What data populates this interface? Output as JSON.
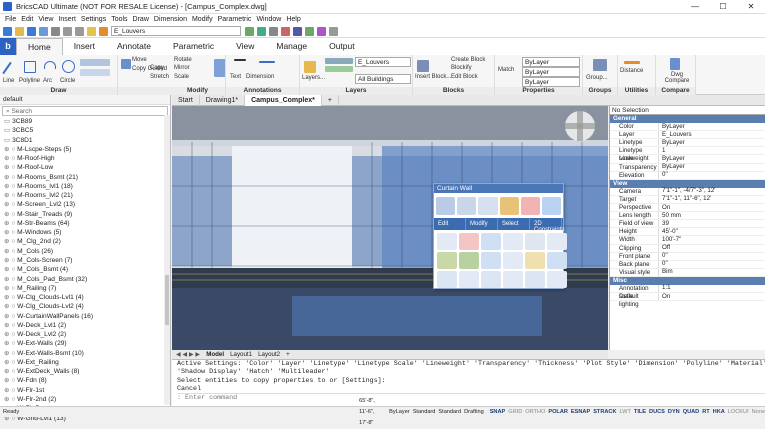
{
  "window": {
    "title": "BricsCAD Ultimate (NOT FOR RESALE License) - [Campus_Complex.dwg]",
    "controls": [
      "—",
      "☐",
      "✕"
    ]
  },
  "menu": [
    "File",
    "Edit",
    "View",
    "Insert",
    "Settings",
    "Tools",
    "Draw",
    "Dimension",
    "Modify",
    "Parametric",
    "Window",
    "Help"
  ],
  "qat": {
    "layer_combo": "E_Louvers"
  },
  "ribbon": {
    "tabs": [
      "Home",
      "Insert",
      "Annotate",
      "Parametric",
      "View",
      "Manage",
      "Output"
    ],
    "active_tab": "Home",
    "groups": {
      "draw": "Draw",
      "modify": "Modify",
      "annotations": "Annotations",
      "layers": "Layers",
      "blocks": "Blocks",
      "properties": "Properties",
      "groups": "Groups",
      "utilities": "Utilities",
      "compare": "Compare"
    },
    "draw_items": [
      "Line",
      "Polyline",
      "Arc",
      "Circle"
    ],
    "modify_items": [
      "Move",
      "Rotate",
      "Mirror",
      "Scale",
      "Copy",
      "Stretch",
      "Copy Guided"
    ],
    "annot_items": [
      "Text",
      "Dimension"
    ],
    "layer_items": {
      "button": "Layers...",
      "combo": "E_Louvers",
      "filter": "All Buildings"
    },
    "block_items": [
      "Create Block",
      "Blockify",
      "Edit Block",
      "Insert Block..."
    ],
    "prop_items": {
      "match": "Match",
      "bylayer1": "ByLayer",
      "bylayer2": "ByLayer",
      "bylayer3": "ByLayer"
    },
    "util_items": [
      "Group...",
      "Distance",
      "Dwg Compare"
    ]
  },
  "doc_tabs": [
    "Start",
    "Drawing1*",
    "Campus_Complex*",
    "+"
  ],
  "active_doc": "Campus_Complex*",
  "left_panel": {
    "header": "default",
    "search_placeholder": "Search",
    "items": [
      "3CB89",
      "3CBC5",
      "3C8D1",
      "M-Lscpe-Steps (5)",
      "M-Roof-High",
      "M-Roof-Low",
      "M-Rooms_Bsmt (21)",
      "M-Rooms_lvl1 (18)",
      "M-Rooms_lvl2 (21)",
      "M-Screen_Lvl2 (13)",
      "M-Stair_Treads (9)",
      "M-Str-Beams (64)",
      "M-Windows (5)",
      "M_Clg_2nd (2)",
      "M_Cols (26)",
      "M_Cols-Screen (7)",
      "M_Cols_Bsmt (4)",
      "M_Cols_Pad_Bsmt (32)",
      "M_Railing (7)",
      "W-Clg_Clouds-Lvl1 (4)",
      "W-Clg_Clouds-Lvl2 (4)",
      "W-CurtainWallPanels (16)",
      "W-Deck_Lvl1 (2)",
      "W-Deck_Lvl2 (2)",
      "W-Ext-Walls (29)",
      "W-Ext-Walls-Bsmt (10)",
      "W-Ext_Railing",
      "W-ExtDeck_Walls (8)",
      "W-Fdn (8)",
      "W-Flr-1st",
      "W-Flr-2nd (2)",
      "W-Flr-Bsmt",
      "W-Grid-Lvl1 (13)"
    ]
  },
  "properties": {
    "selector": "No Selection",
    "sections": [
      {
        "name": "General",
        "rows": [
          [
            "Color",
            "ByLayer"
          ],
          [
            "Layer",
            "E_Louvers"
          ],
          [
            "Linetype",
            "ByLayer"
          ],
          [
            "Linetype scale",
            "1"
          ],
          [
            "Lineweight",
            "ByLayer"
          ],
          [
            "Transparency",
            "ByLayer"
          ],
          [
            "Elevation",
            "0\""
          ]
        ]
      },
      {
        "name": "View",
        "rows": [
          [
            "Camera",
            "7'1\"-1\", -4/7\"-3\", 12'"
          ],
          [
            "Target",
            "7'1\"-1\", 11\"-6\", 12'"
          ],
          [
            "Perspective",
            "On"
          ],
          [
            "Lens length",
            "50 mm"
          ],
          [
            "Field of view",
            "39"
          ],
          [
            "Height",
            "45'-0\""
          ],
          [
            "Width",
            "100'-7\""
          ],
          [
            "Clipping",
            "Off"
          ],
          [
            "Front plane",
            "0\""
          ],
          [
            "Back plane",
            "0\""
          ],
          [
            "Visual style",
            "Bim"
          ]
        ]
      },
      {
        "name": "Misc",
        "rows": [
          [
            "Annotation scale",
            "1:1"
          ],
          [
            "Default lighting",
            "On"
          ]
        ]
      }
    ]
  },
  "quad": {
    "title": "Curtain Wall",
    "tabs": [
      "Edit",
      "Modify",
      "Select",
      "2D Constraints"
    ]
  },
  "layout_tabs": [
    "Model",
    "Layout1",
    "Layout2",
    "+"
  ],
  "command_lines": [
    "Active Settings: 'Color' 'Layer' 'Linetype' 'Linetype Scale' 'Lineweight' 'Transparency' 'Thickness' 'Plot Style' 'Dimension' 'Polyline' 'Material' 'Text'",
    "'Shadow Display' 'Hatch' 'Multileader'",
    "Select entities to copy properties to or [Settings]:",
    "Cancel"
  ],
  "command_prompt": ": Enter command",
  "status": {
    "ready": "Ready",
    "coords": "65'-8\", 11'-6\", 17'-8\"",
    "items": [
      "ByLayer",
      "Standard",
      "Standard",
      "Drafting"
    ],
    "toggles": [
      "SNAP",
      "GRID",
      "ORTHO",
      "POLAR",
      "ESNAP",
      "STRACK",
      "LWT",
      "TILE",
      "DUCS",
      "DYN",
      "QUAD",
      "RT",
      "HKA",
      "LOCKUI",
      "None"
    ],
    "on": [
      "SNAP",
      "POLAR",
      "ESNAP",
      "STRACK",
      "TILE",
      "DUCS",
      "DYN",
      "QUAD",
      "RT",
      "HKA"
    ]
  },
  "colors": {
    "accent": "#2b62c4",
    "section": "#5a7eb0",
    "quad_header": "#4b77b8"
  }
}
